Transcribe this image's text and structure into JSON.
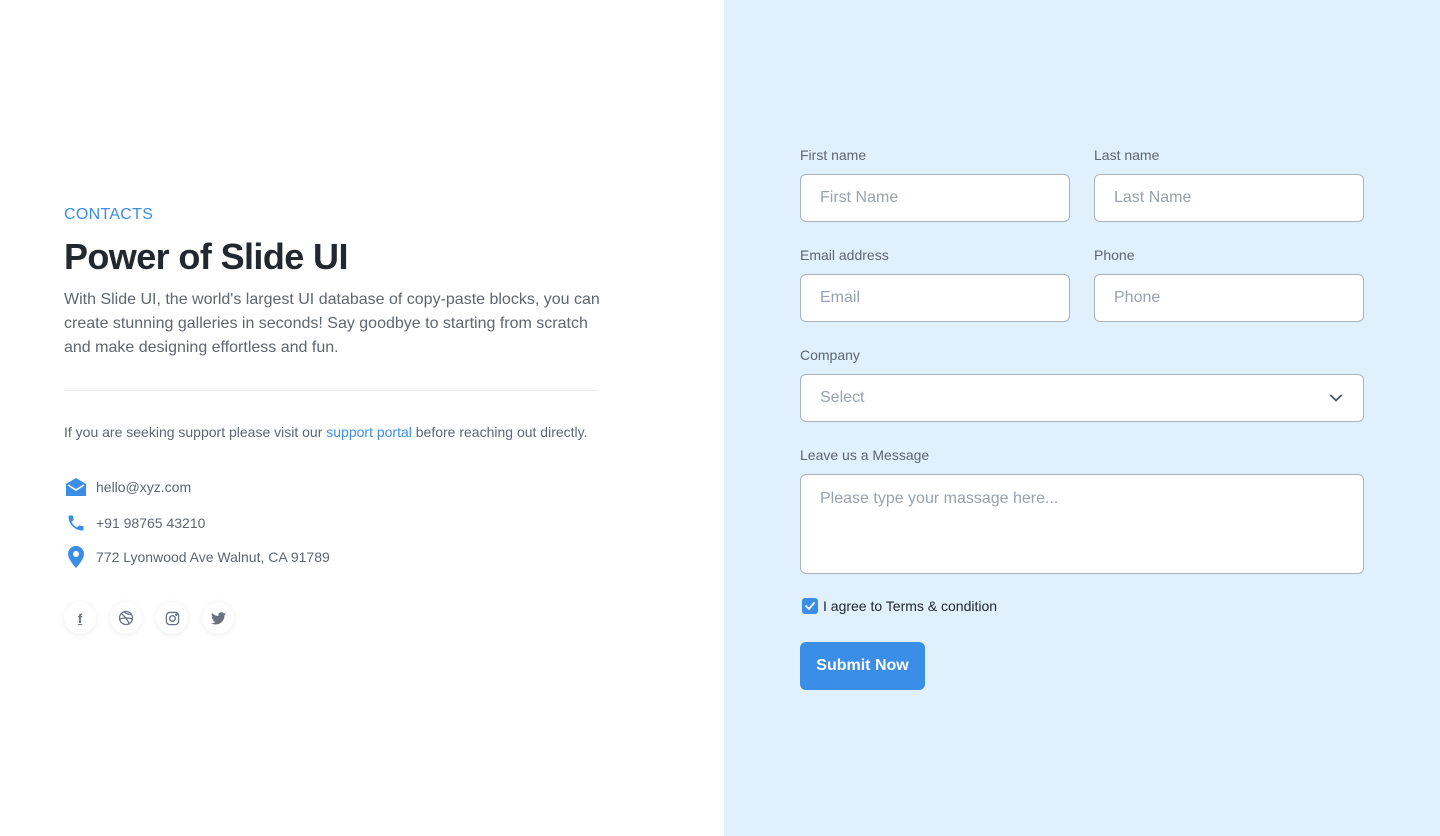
{
  "hero": {
    "eyebrow": "CONTACTS",
    "title": "Power of Slide UI",
    "description": "With Slide UI, the world's largest UI database of copy-paste blocks, you can create stunning galleries in seconds! Say goodbye to starting from scratch and make designing effortless and fun."
  },
  "support": {
    "before": "If you are seeking support please visit our ",
    "link": "support portal",
    "after": " before reaching out directly."
  },
  "contacts": {
    "email": "hello@xyz.com",
    "phone": "+91 98765 43210",
    "address": "772 Lyonwood Ave Walnut, CA 91789"
  },
  "social": {
    "icons": [
      "facebook-icon",
      "dribbble-icon",
      "instagram-icon",
      "twitter-icon"
    ],
    "facebook_glyph": "f"
  },
  "form": {
    "first_name_label": "First name",
    "first_name_placeholder": "First Name",
    "last_name_label": "Last name",
    "last_name_placeholder": "Last Name",
    "email_label": "Email address",
    "email_placeholder": "Email",
    "phone_label": "Phone",
    "phone_placeholder": "Phone",
    "company_label": "Company",
    "company_selected": "Select",
    "message_label": "Leave us a Message",
    "message_placeholder": "Please type your massage here...",
    "agree_label": "I agree to Terms & condition",
    "agree_checked": true,
    "submit_label": "Submit Now"
  },
  "colors": {
    "accent": "#3b8ee8",
    "panel_background": "#e0f0fd",
    "heading": "#23272e",
    "body_text": "#5f6670"
  }
}
